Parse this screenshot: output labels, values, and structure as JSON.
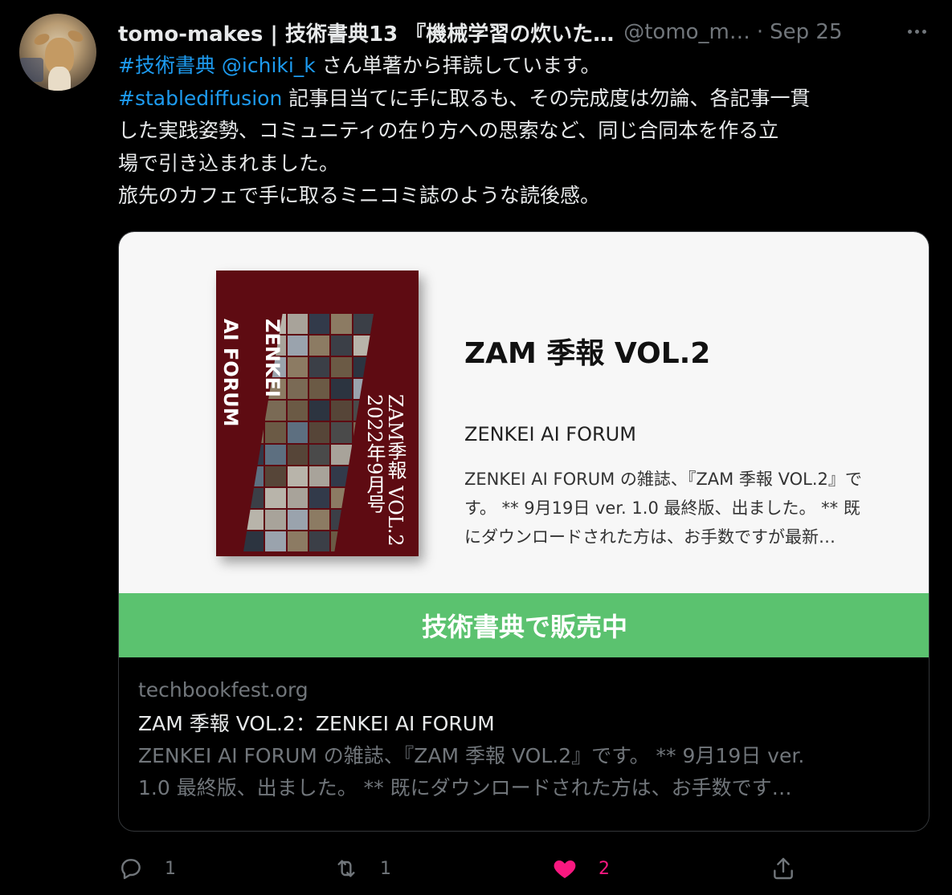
{
  "tweet": {
    "display_name": "tomo-makes | 技術書典13 『機械学習の炊いた…",
    "handle": "@tomo_m…",
    "separator": "·",
    "date": "Sep 25",
    "text_lines": [
      [
        {
          "t": "#技術書典",
          "link": true
        },
        {
          "t": " ",
          "link": false
        },
        {
          "t": "@ichiki_k",
          "link": true
        },
        {
          "t": " さん単著から拝読しています。",
          "link": false
        }
      ],
      [
        {
          "t": "#stablediffusion",
          "link": true
        },
        {
          "t": " 記事目当てに手に取るも、その完成度は勿論、各記事一貫",
          "link": false
        }
      ],
      [
        {
          "t": "した実践姿勢、コミュニティの在り方への思索など、同じ合同本を作る立",
          "link": false
        }
      ],
      [
        {
          "t": "場で引き込まれました。",
          "link": false
        }
      ],
      [
        {
          "t": "旅先のカフェで手に取るミニコミ誌のような読後感。",
          "link": false
        }
      ]
    ]
  },
  "card_image": {
    "book_cover": {
      "title_latin_1": "ZENKEI",
      "title_latin_2": "AI FORUM",
      "title_jp_1": "ZAM季報 VOL.2",
      "title_jp_2": "2022年9月号",
      "color": "#5e0b12"
    },
    "title": "ZAM 季報 VOL.2",
    "author": "ZENKEI AI FORUM",
    "description_lines": [
      "ZENKEI AI FORUM の雑誌、『ZAM 季報 VOL.2』で",
      "す。 ** 9月19日 ver. 1.0 最終版、出ました。 ** 既",
      "にダウンロードされた方は、お手数ですが最新…"
    ],
    "banner": "技術書典で販売中",
    "banner_color": "#5bc26f"
  },
  "card": {
    "domain": "techbookfest.org",
    "title": "ZAM 季報 VOL.2：ZENKEI AI FORUM",
    "description_lines": [
      "ZENKEI AI FORUM の雑誌、『ZAM 季報 VOL.2』です。 ** 9月19日 ver.",
      "1.0 最終版、出ました。 ** 既にダウンロードされた方は、お手数です…"
    ]
  },
  "actions": {
    "reply_count": "1",
    "retweet_count": "1",
    "like_count": "2",
    "like_color": "#f91880",
    "icons": [
      "reply-icon",
      "retweet-icon",
      "heart-icon",
      "share-icon"
    ]
  },
  "colors": {
    "background": "#000000",
    "link": "#1d9bf0",
    "secondary_text": "#71767b"
  }
}
